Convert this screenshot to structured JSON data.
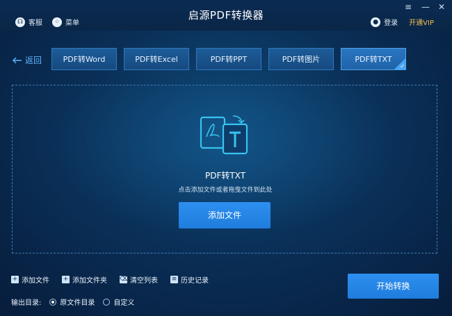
{
  "window": {
    "title": "启源PDF转换器",
    "controls": {
      "menu": "≡",
      "minimize": "—",
      "close": "✕"
    }
  },
  "topbar": {
    "support_label": "客服",
    "menu_label": "菜单",
    "login_label": "登录",
    "vip_label": "开通VIP"
  },
  "nav": {
    "back_label": "返回"
  },
  "tabs": [
    {
      "label": "PDF转Word",
      "active": false
    },
    {
      "label": "PDF转Excel",
      "active": false
    },
    {
      "label": "PDF转PPT",
      "active": false
    },
    {
      "label": "PDF转图片",
      "active": false
    },
    {
      "label": "PDF转TXT",
      "active": true
    }
  ],
  "dropzone": {
    "title": "PDF转TXT",
    "hint": "点击添加文件或者拖曳文件到此处",
    "add_button": "添加文件"
  },
  "actions": {
    "add_file": "添加文件",
    "add_folder": "添加文件夹",
    "clear_list": "清空列表",
    "history": "历史记录"
  },
  "output": {
    "label": "输出目录:",
    "options": [
      {
        "label": "原文件目录",
        "selected": true
      },
      {
        "label": "自定义",
        "selected": false
      }
    ]
  },
  "start_button": "开始转换",
  "colors": {
    "accent": "#2d8ff0",
    "vip": "#f3c14f",
    "background": "#0a2f57",
    "link": "#5fb4ff"
  }
}
